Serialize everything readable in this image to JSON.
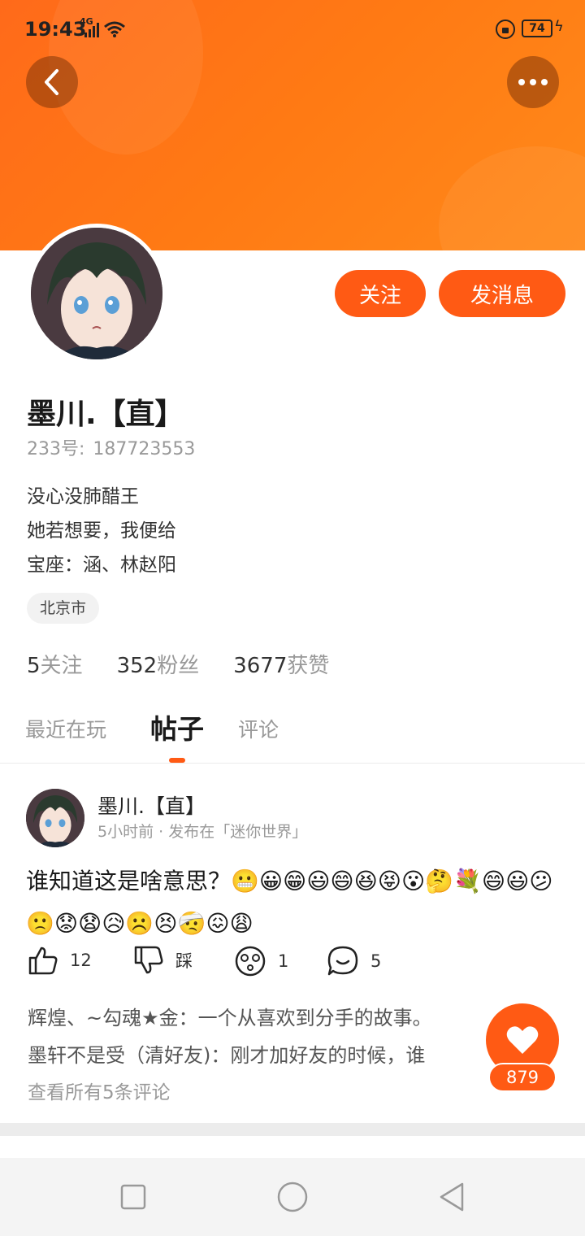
{
  "status_bar": {
    "time": "19:43",
    "network": "4G",
    "battery": "74"
  },
  "header": {
    "back_icon": "chevron-left-icon",
    "more_icon": "more-dots-icon"
  },
  "profile": {
    "follow_label": "关注",
    "message_label": "发消息",
    "nickname": "墨川.【直】",
    "uid_label": "233号:",
    "uid_value": "187723553",
    "bio": [
      "没心没肺醋王",
      "她若想要，我便给",
      "宝座：涵、林赵阳"
    ],
    "location": "北京市",
    "stats": [
      {
        "num": "5",
        "label": "关注"
      },
      {
        "num": "352",
        "label": "粉丝"
      },
      {
        "num": "3677",
        "label": "获赞"
      }
    ]
  },
  "tabs": [
    "最近在玩",
    "帖子",
    "评论"
  ],
  "active_tab": "帖子",
  "post": {
    "author": "墨川.【直】",
    "meta": "5小时前 · 发布在「迷你世界」",
    "text": "谁知道这是啥意思？😬😀😁😃😄😆😝😮🤔💐😄😃😕🙁😟😧😥☹️😣🤕😖😩",
    "actions": {
      "like_count": "12",
      "dislike_label": "踩",
      "emoji_count": "1",
      "comment_count": "5"
    },
    "comments": [
      "辉煌、~勾魂★金：一个从喜欢到分手的故事。",
      "墨轩不是受（清好友)：刚才加好友的时候，谁"
    ],
    "view_all": "查看所有5条评论"
  },
  "fab": {
    "count": "879",
    "icon": "heart-icon"
  },
  "colors": {
    "accent": "#ff5a14",
    "banner": "#ff7a14"
  }
}
